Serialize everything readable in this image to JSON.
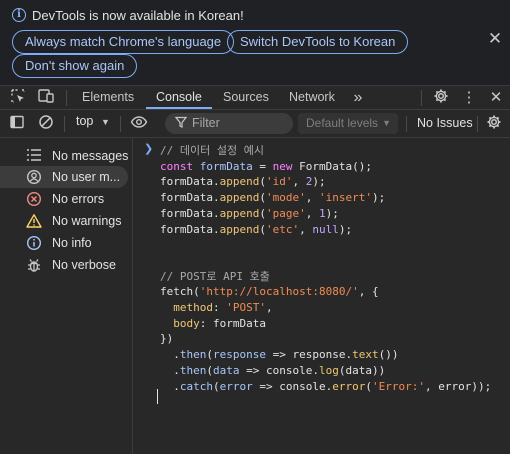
{
  "infobar": {
    "message": "DevTools is now available in Korean!",
    "buttons": [
      "Always match Chrome's language",
      "Switch DevTools to Korean",
      "Don't show again"
    ]
  },
  "tabs": [
    "Elements",
    "Console",
    "Sources",
    "Network"
  ],
  "active_tab": "Console",
  "console_toolbar": {
    "context": "top",
    "filter_placeholder": "Filter",
    "levels": "Default levels",
    "issues": "No Issues"
  },
  "sidebar": {
    "items": [
      {
        "label": "No messages",
        "icon": "list-icon"
      },
      {
        "label": "No user m...",
        "icon": "user-icon"
      },
      {
        "label": "No errors",
        "icon": "error-icon"
      },
      {
        "label": "No warnings",
        "icon": "warning-icon"
      },
      {
        "label": "No info",
        "icon": "info-icon"
      },
      {
        "label": "No verbose",
        "icon": "bug-icon"
      }
    ],
    "selected": 1
  },
  "colors": {
    "accent": "#7cacf8",
    "error": "#f28b82",
    "warning": "#fdd663",
    "info": "#a8c7fa"
  },
  "code": {
    "lines": [
      [
        [
          "c-cm",
          "// 데이터 설정 예시"
        ]
      ],
      [
        [
          "c-kw",
          "const "
        ],
        [
          "c-var",
          "formData"
        ],
        [
          "",
          " = "
        ],
        [
          "c-kw",
          "new "
        ],
        [
          "",
          "FormData();"
        ]
      ],
      [
        [
          "",
          "formData."
        ],
        [
          "c-fn",
          "append"
        ],
        [
          "",
          "("
        ],
        [
          "c-str",
          "'id'"
        ],
        [
          "",
          ", "
        ],
        [
          "c-num",
          "2"
        ],
        [
          "",
          ");"
        ]
      ],
      [
        [
          "",
          "formData."
        ],
        [
          "c-fn",
          "append"
        ],
        [
          "",
          "("
        ],
        [
          "c-str",
          "'mode'"
        ],
        [
          "",
          ", "
        ],
        [
          "c-str",
          "'insert'"
        ],
        [
          "",
          ");"
        ]
      ],
      [
        [
          "",
          "formData."
        ],
        [
          "c-fn",
          "append"
        ],
        [
          "",
          "("
        ],
        [
          "c-str",
          "'page'"
        ],
        [
          "",
          ", "
        ],
        [
          "c-num",
          "1"
        ],
        [
          "",
          ");"
        ]
      ],
      [
        [
          "",
          "formData."
        ],
        [
          "c-fn",
          "append"
        ],
        [
          "",
          "("
        ],
        [
          "c-str",
          "'etc'"
        ],
        [
          "",
          ", "
        ],
        [
          "c-num",
          "null"
        ],
        [
          "",
          ");"
        ]
      ],
      [
        [
          "",
          ""
        ]
      ],
      [
        [
          "",
          ""
        ]
      ],
      [
        [
          "c-cm",
          "// POST로 API 호출"
        ]
      ],
      [
        [
          "",
          "fetch("
        ],
        [
          "c-str",
          "'http://localhost:8080/'"
        ],
        [
          "",
          ", {"
        ]
      ],
      [
        [
          "",
          "  "
        ],
        [
          "c-fn",
          "method"
        ],
        [
          "",
          ": "
        ],
        [
          "c-str",
          "'POST'"
        ],
        [
          "",
          ","
        ]
      ],
      [
        [
          "",
          "  "
        ],
        [
          "c-fn",
          "body"
        ],
        [
          "",
          ": formData"
        ]
      ],
      [
        [
          "",
          "})"
        ]
      ],
      [
        [
          "",
          "  ."
        ],
        [
          "c-var",
          "then"
        ],
        [
          "",
          "("
        ],
        [
          "c-var",
          "response"
        ],
        [
          "",
          " => response."
        ],
        [
          "c-fn",
          "text"
        ],
        [
          "",
          "())"
        ]
      ],
      [
        [
          "",
          "  ."
        ],
        [
          "c-var",
          "then"
        ],
        [
          "",
          "("
        ],
        [
          "c-var",
          "data"
        ],
        [
          "",
          " => console."
        ],
        [
          "c-fn",
          "log"
        ],
        [
          "",
          "(data))"
        ]
      ],
      [
        [
          "",
          "  ."
        ],
        [
          "c-var",
          "catch"
        ],
        [
          "",
          "("
        ],
        [
          "c-var",
          "error"
        ],
        [
          "",
          " => console."
        ],
        [
          "c-fn",
          "error"
        ],
        [
          "",
          "("
        ],
        [
          "c-str",
          "'Error:'"
        ],
        [
          "",
          ", error));"
        ]
      ]
    ]
  }
}
